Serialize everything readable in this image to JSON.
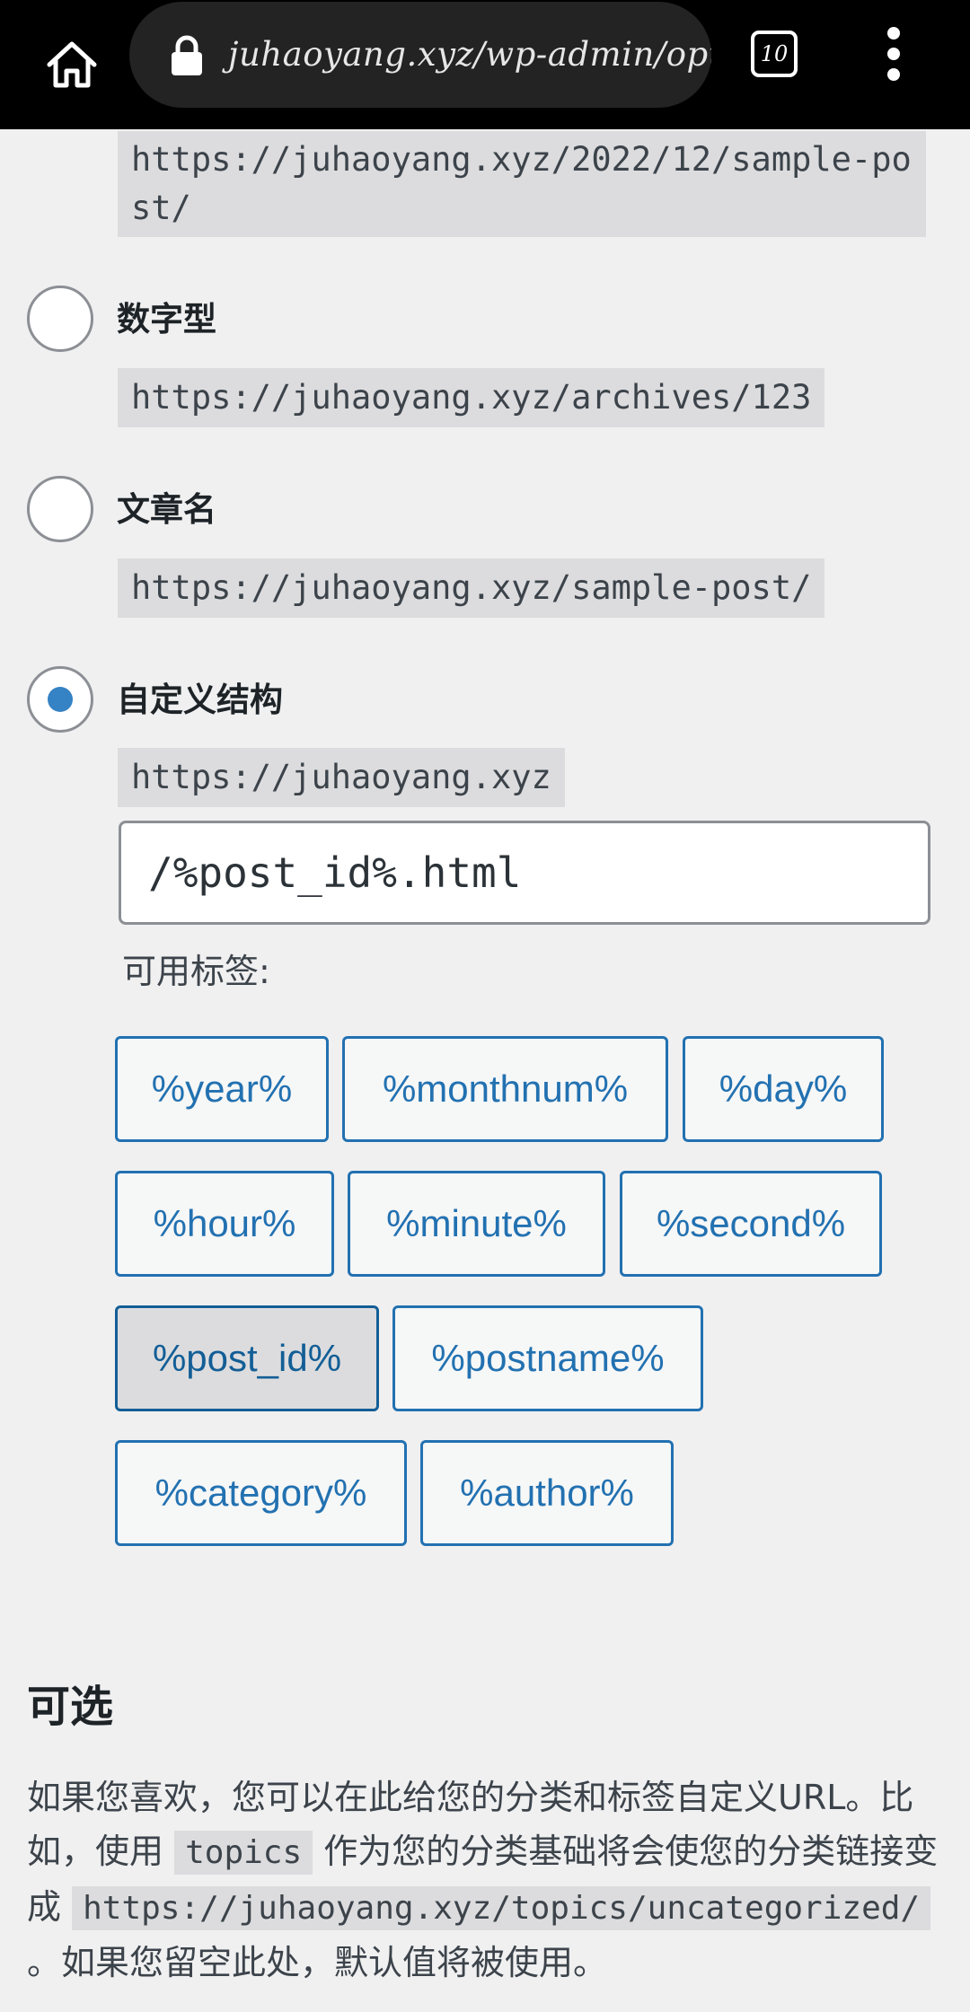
{
  "browser": {
    "url": "juhaoyang.xyz/wp-admin/optior",
    "tab_count": "10"
  },
  "permalinks": {
    "month_name_example": "https://juhaoyang.xyz/2022/12/sample-post/",
    "options": [
      {
        "label": "数字型",
        "example": "https://juhaoyang.xyz/archives/123",
        "checked": false
      },
      {
        "label": "文章名",
        "example": "https://juhaoyang.xyz/sample-post/",
        "checked": false
      },
      {
        "label": "自定义结构",
        "example": "https://juhaoyang.xyz",
        "checked": true
      }
    ],
    "custom_structure_value": "/%post_id%.html",
    "available_tags_label": "可用标签:",
    "tags": [
      {
        "label": "%year%",
        "active": false
      },
      {
        "label": "%monthnum%",
        "active": false
      },
      {
        "label": "%day%",
        "active": false
      },
      {
        "label": "%hour%",
        "active": false
      },
      {
        "label": "%minute%",
        "active": false
      },
      {
        "label": "%second%",
        "active": false
      },
      {
        "label": "%post_id%",
        "active": true
      },
      {
        "label": "%postname%",
        "active": false
      },
      {
        "label": "%category%",
        "active": false
      },
      {
        "label": "%author%",
        "active": false
      }
    ]
  },
  "optional": {
    "title": "可选",
    "desc_part1": "如果您喜欢，您可以在此给您的分类和标签自定义URL。比如，使用",
    "desc_code1": "topics",
    "desc_part2": "作为您的分类基础将会使您的分类链接变成",
    "desc_code2": "https://juhaoyang.xyz/topics/uncategorized/",
    "desc_part3": "。如果您留空此处，默认值将被使用。"
  },
  "colors": {
    "accent": "#2271b1",
    "radio_checked": "#3582c4",
    "background": "#f0f0f1"
  }
}
